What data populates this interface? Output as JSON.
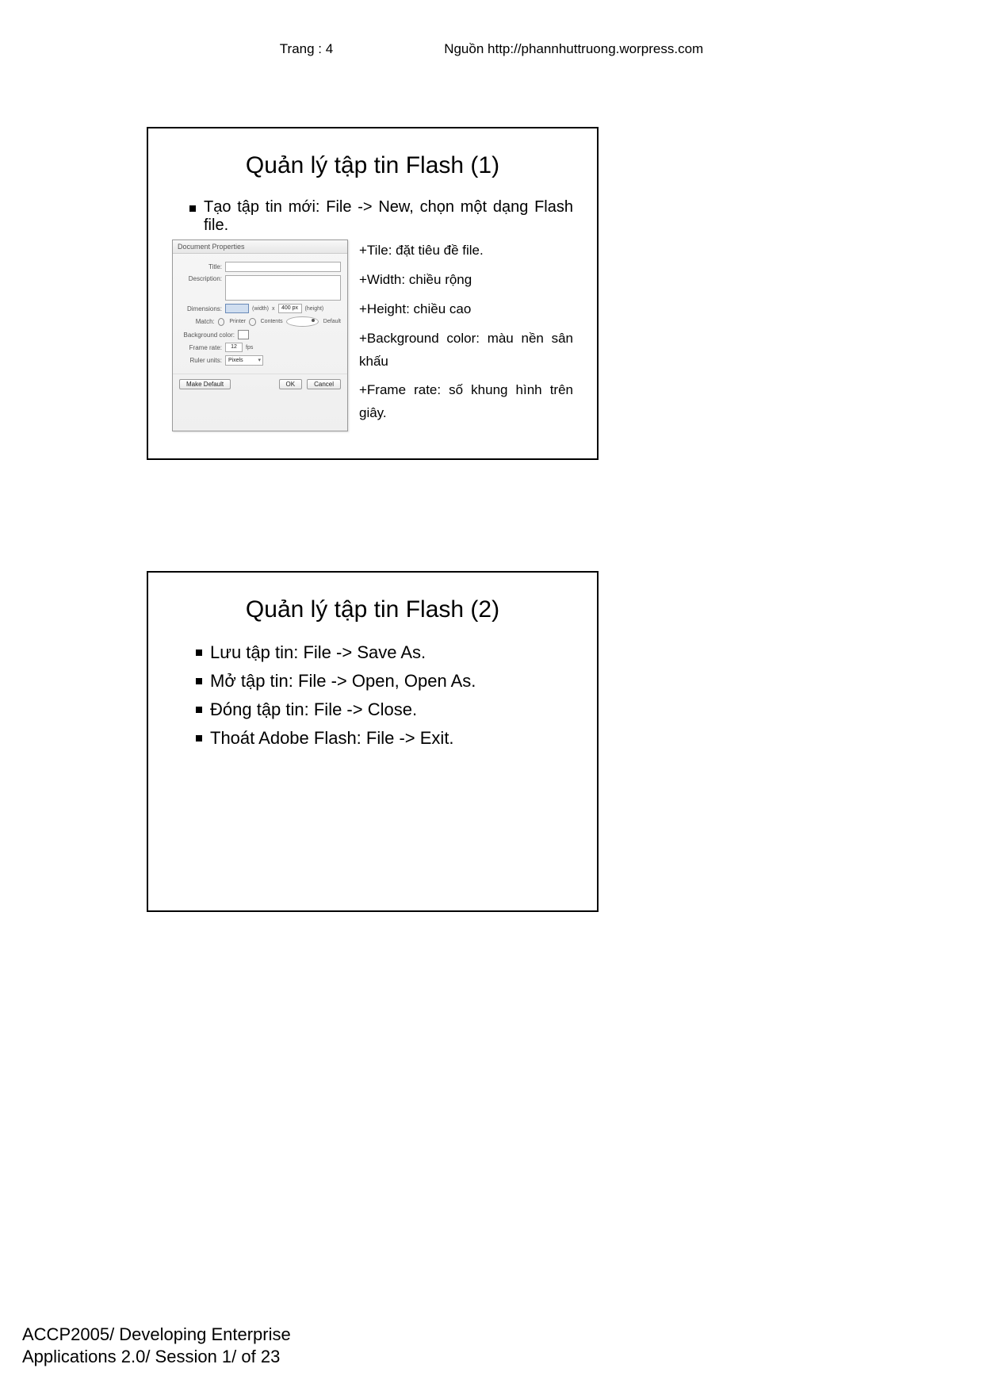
{
  "header": {
    "page_label": "Trang : 4",
    "source_label": "Nguồn http://phannhuttruong.worpress.com"
  },
  "slide1": {
    "title": "Quản lý tập tin Flash (1)",
    "bullet1": "Tạo tập tin mới: File -> New, chọn một dạng Flash file.",
    "dialog": {
      "title": "Document Properties",
      "labels": {
        "title": "Title:",
        "description": "Description:",
        "dimensions": "Dimensions:",
        "width_hint": "(width)",
        "x": "x",
        "height_val": "400 px",
        "height_hint": "(height)",
        "match": "Match:",
        "printer": "Printer",
        "contents": "Contents",
        "default": "Default",
        "bgcolor": "Background color:",
        "framerate": "Frame rate:",
        "framerate_val": "12",
        "fps": "fps",
        "ruler": "Ruler units:",
        "ruler_val": "Pixels",
        "make_default": "Make Default",
        "ok": "OK",
        "cancel": "Cancel"
      }
    },
    "explain": {
      "tile": "+Tile: đặt tiêu đề file.",
      "width": "+Width: chiều rộng",
      "height": "+Height: chiều cao",
      "bg": "+Background color: màu nền sân khấu",
      "fr": "+Frame rate: số khung hình trên giây."
    }
  },
  "slide2": {
    "title": "Quản lý tập tin Flash (2)",
    "bullets": [
      "Lưu tập tin: File -> Save As.",
      "Mở tập tin: File -> Open, Open As.",
      "Đóng tập tin: File -> Close.",
      "Thoát Adobe Flash: File -> Exit."
    ]
  },
  "footer": {
    "line1": "ACCP2005/ Developing Enterprise",
    "line2": "Applications 2.0/ Session 1/ of 23"
  }
}
